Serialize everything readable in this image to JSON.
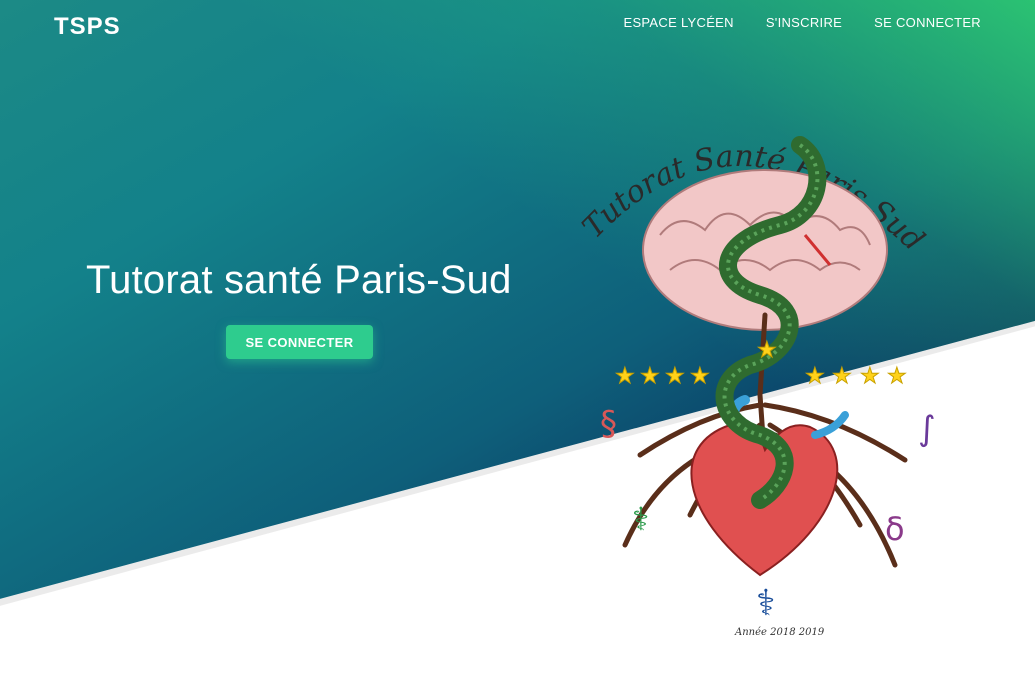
{
  "brand": "TSPS",
  "nav": {
    "items": [
      {
        "label": "ESPACE LYCÉEN"
      },
      {
        "label": "S'INSCRIRE"
      },
      {
        "label": "SE CONNECTER"
      }
    ]
  },
  "hero": {
    "title": "Tutorat santé Paris-Sud",
    "cta_label": "SE CONNECTER"
  },
  "logo": {
    "arc_text": "Tutorat Santé Paris Sud",
    "year_text": "Année 2018 2019"
  },
  "colors": {
    "accent": "#2ecc8e",
    "gradient_top": "#1c8a86",
    "gradient_bottom": "#06183e"
  }
}
